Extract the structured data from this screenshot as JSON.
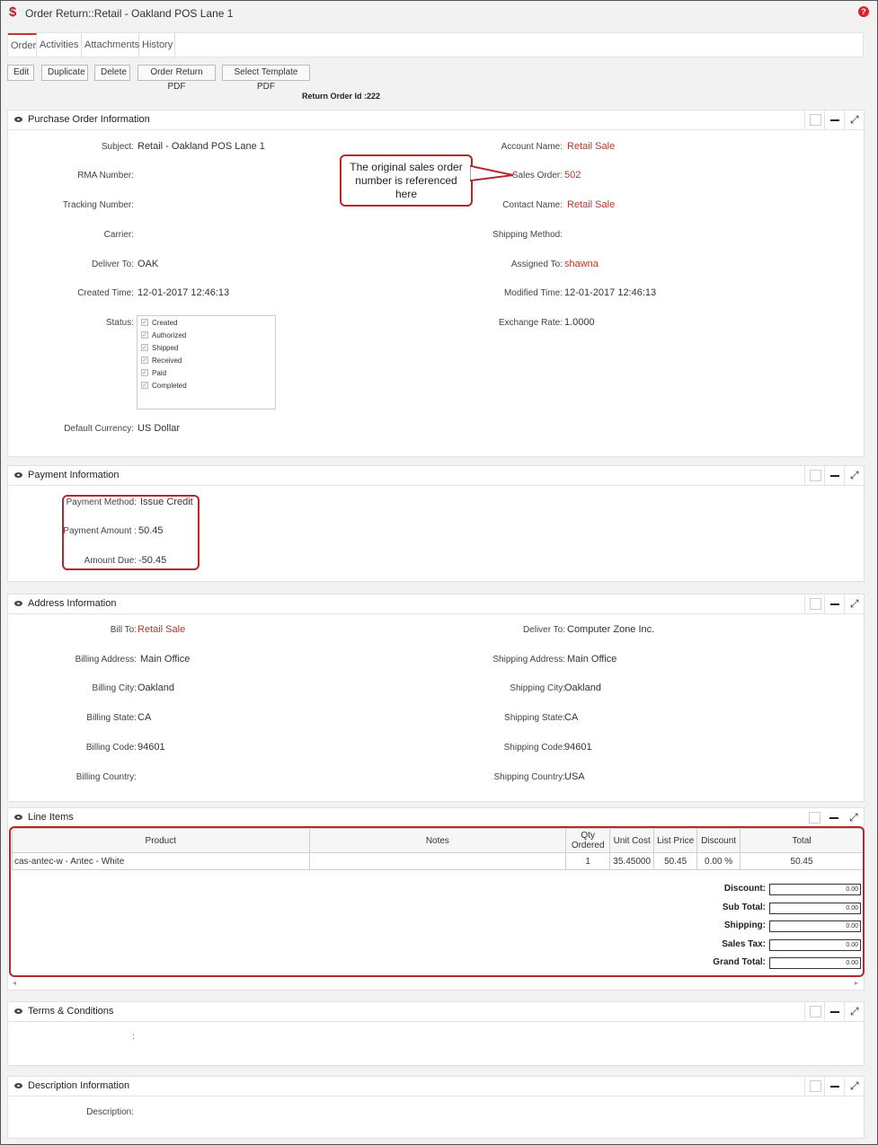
{
  "window": {
    "title": "Order Return::Retail - Oakland POS Lane 1",
    "help": "?"
  },
  "tabs": [
    "Order",
    "Activities",
    "Attachments",
    "History"
  ],
  "toolbar": {
    "edit": "Edit",
    "duplicate": "Duplicate",
    "delete": "Delete",
    "order_return_pdf": "Order Return PDF",
    "select_template_pdf": "Select Template PDF"
  },
  "return_order_id": "Return Order Id :222",
  "purchase_order": {
    "title": "Purchase Order Information",
    "subject_label": "Subject:",
    "subject": "Retail - Oakland POS Lane 1",
    "rma_label": "RMA Number:",
    "tracking_label": "Tracking Number:",
    "carrier_label": "Carrier:",
    "deliver_to_label": "Deliver To:",
    "deliver_to": "OAK",
    "created_time_label": "Created Time:",
    "created_time": "12-01-2017 12:46:13",
    "status_label": "Status:",
    "status_options": [
      "Created",
      "Authorized",
      "Shipped",
      "Received",
      "Paid",
      "Completed"
    ],
    "default_currency_label": "Default Currency:",
    "default_currency": "US Dollar",
    "account_name_label": "Account Name:",
    "account_name": "Retail Sale",
    "sales_order_label": "Sales Order:",
    "sales_order": "502",
    "contact_name_label": "Contact Name:",
    "contact_name": "Retail Sale",
    "shipping_method_label": "Shipping Method:",
    "assigned_to_label": "Assigned To:",
    "assigned_to": "shawna",
    "modified_time_label": "Modified Time:",
    "modified_time": "12-01-2017 12:46:13",
    "exchange_rate_label": "Exchange Rate:",
    "exchange_rate": "1.0000"
  },
  "callout": {
    "line1": "The original sales order",
    "line2": "number is referenced",
    "line3": "here"
  },
  "payment": {
    "title": "Payment Information",
    "method_label": "Payment Method:",
    "method": "Issue Credit",
    "amount_label": "Payment Amount :",
    "amount": "50.45",
    "due_label": "Amount Due:",
    "due": "-50.45"
  },
  "address": {
    "title": "Address Information",
    "bill_to_label": "Bill To:",
    "bill_to": "Retail Sale",
    "billing_address_label": "Billing Address:",
    "billing_address": "Main Office",
    "billing_city_label": "Billing City:",
    "billing_city": "Oakland",
    "billing_state_label": "Billing State:",
    "billing_state": "CA",
    "billing_code_label": "Billing Code:",
    "billing_code": "94601",
    "billing_country_label": "Billing Country:",
    "deliver_to_label": "Deliver To:",
    "deliver_to": "Computer Zone Inc.",
    "shipping_address_label": "Shipping Address:",
    "shipping_address": "Main Office",
    "shipping_city_label": "Shipping City:",
    "shipping_city": "Oakland",
    "shipping_state_label": "Shipping State:",
    "shipping_state": "CA",
    "shipping_code_label": "Shipping Code:",
    "shipping_code": "94601",
    "shipping_country_label": "Shipping Country:",
    "shipping_country": "USA"
  },
  "line_items": {
    "title": "Line Items",
    "columns": [
      "Product",
      "Notes",
      "Qty Ordered",
      "Unit Cost",
      "List Price",
      "Discount",
      "Total"
    ],
    "rows": [
      {
        "product": "cas-antec-w - Antec - White",
        "notes": "",
        "qty": "1",
        "unit_cost": "35.45000",
        "list_price": "50.45",
        "discount": "0.00 %",
        "total": "50.45"
      }
    ],
    "totals": {
      "discount_label": "Discount:",
      "discount": "0.00",
      "sub_total_label": "Sub Total:",
      "sub_total": "0.00",
      "shipping_label": "Shipping:",
      "shipping": "0.00",
      "sales_tax_label": "Sales Tax:",
      "sales_tax": "0.00",
      "grand_total_label": "Grand Total:",
      "grand_total": "0.00"
    }
  },
  "terms": {
    "title": "Terms & Conditions",
    "label": ":"
  },
  "description": {
    "title": "Description Information",
    "label": "Description:"
  },
  "colors": {
    "accent": "#b5282e",
    "link": "#b03a2e"
  }
}
